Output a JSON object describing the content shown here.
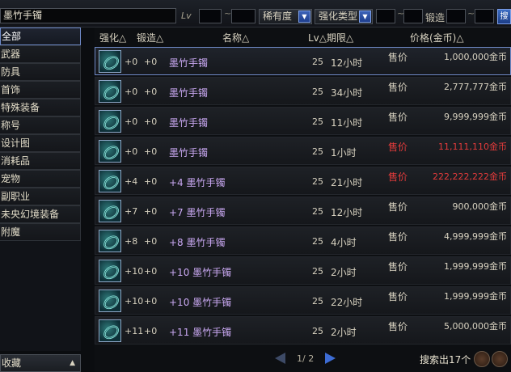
{
  "search": {
    "value": "墨竹手镯",
    "lv_label": "Lv",
    "tilde": "~",
    "rarity_label": "稀有度",
    "enhance_type_label": "强化类型",
    "forge_label": "锻造",
    "go_label": "搜"
  },
  "sidebar": {
    "items": [
      {
        "label": "全部"
      },
      {
        "label": "武器"
      },
      {
        "label": "防具"
      },
      {
        "label": "首饰"
      },
      {
        "label": "特殊装备"
      },
      {
        "label": "称号"
      },
      {
        "label": "设计图"
      },
      {
        "label": "消耗品"
      },
      {
        "label": "宠物"
      },
      {
        "label": "副职业"
      },
      {
        "label": "未央幻境装备"
      },
      {
        "label": "附魔"
      }
    ],
    "favorites": "收藏",
    "favorites_arrow": "▲"
  },
  "table": {
    "headers": {
      "enhance": "强化△",
      "forge": "锻造△",
      "name": "名称△",
      "lv_period": "Lv△期限△",
      "price": "价格(金币)△"
    },
    "rows": [
      {
        "enhance": "+0",
        "forge": "+0",
        "name": "墨竹手镯",
        "lv": "25",
        "period": "12小时",
        "price_label": "售价",
        "price": "1,000,000金币",
        "red": false
      },
      {
        "enhance": "+0",
        "forge": "+0",
        "name": "墨竹手镯",
        "lv": "25",
        "period": "34小时",
        "price_label": "售价",
        "price": "2,777,777金币",
        "red": false
      },
      {
        "enhance": "+0",
        "forge": "+0",
        "name": "墨竹手镯",
        "lv": "25",
        "period": "11小时",
        "price_label": "售价",
        "price": "9,999,999金币",
        "red": false
      },
      {
        "enhance": "+0",
        "forge": "+0",
        "name": "墨竹手镯",
        "lv": "25",
        "period": "1小时",
        "price_label": "售价",
        "price": "11,111,110金币",
        "red": true
      },
      {
        "enhance": "+4",
        "forge": "+0",
        "name": "+4 墨竹手镯",
        "lv": "25",
        "period": "21小时",
        "price_label": "售价",
        "price": "222,222,222金币",
        "red": true
      },
      {
        "enhance": "+7",
        "forge": "+0",
        "name": "+7 墨竹手镯",
        "lv": "25",
        "period": "12小时",
        "price_label": "售价",
        "price": "900,000金币",
        "red": false
      },
      {
        "enhance": "+8",
        "forge": "+0",
        "name": "+8 墨竹手镯",
        "lv": "25",
        "period": "4小时",
        "price_label": "售价",
        "price": "4,999,999金币",
        "red": false
      },
      {
        "enhance": "+10",
        "forge": "+0",
        "name": "+10 墨竹手镯",
        "lv": "25",
        "period": "2小时",
        "price_label": "售价",
        "price": "1,999,999金币",
        "red": false
      },
      {
        "enhance": "+10",
        "forge": "+0",
        "name": "+10 墨竹手镯",
        "lv": "25",
        "period": "22小时",
        "price_label": "售价",
        "price": "1,999,999金币",
        "red": false
      },
      {
        "enhance": "+11",
        "forge": "+0",
        "name": "+11 墨竹手镯",
        "lv": "25",
        "period": "2小时",
        "price_label": "售价",
        "price": "5,000,000金币",
        "red": false
      }
    ]
  },
  "pager": {
    "text": "1/ 2"
  },
  "results": "搜索出17个",
  "colors": {
    "accent": "#6f8ac8",
    "name": "#c9a8f2",
    "warn": "#e33b3b"
  }
}
